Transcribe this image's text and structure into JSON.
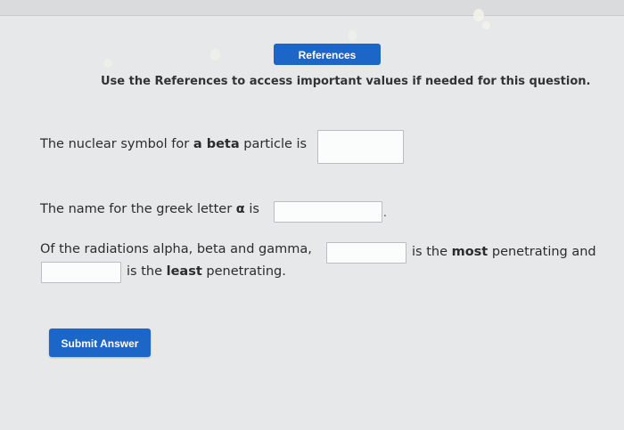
{
  "references_button_label": "References",
  "instructions": "Use the References to access important values if needed for this question.",
  "q1": {
    "prefix": "The nuclear symbol for ",
    "bold": "a beta",
    "suffix": " particle is"
  },
  "q2": {
    "prefix": "The name for the greek letter ",
    "bold": "α",
    "suffix": " is",
    "after": "."
  },
  "q3": {
    "line1_prefix": "Of the radiations alpha, beta and gamma,",
    "line1_mid": "is the ",
    "line1_bold": "most",
    "line1_suffix": " penetrating and",
    "line2_prefix": "is the ",
    "line2_bold": "least",
    "line2_suffix": " penetrating."
  },
  "submit_label": "Submit Answer"
}
